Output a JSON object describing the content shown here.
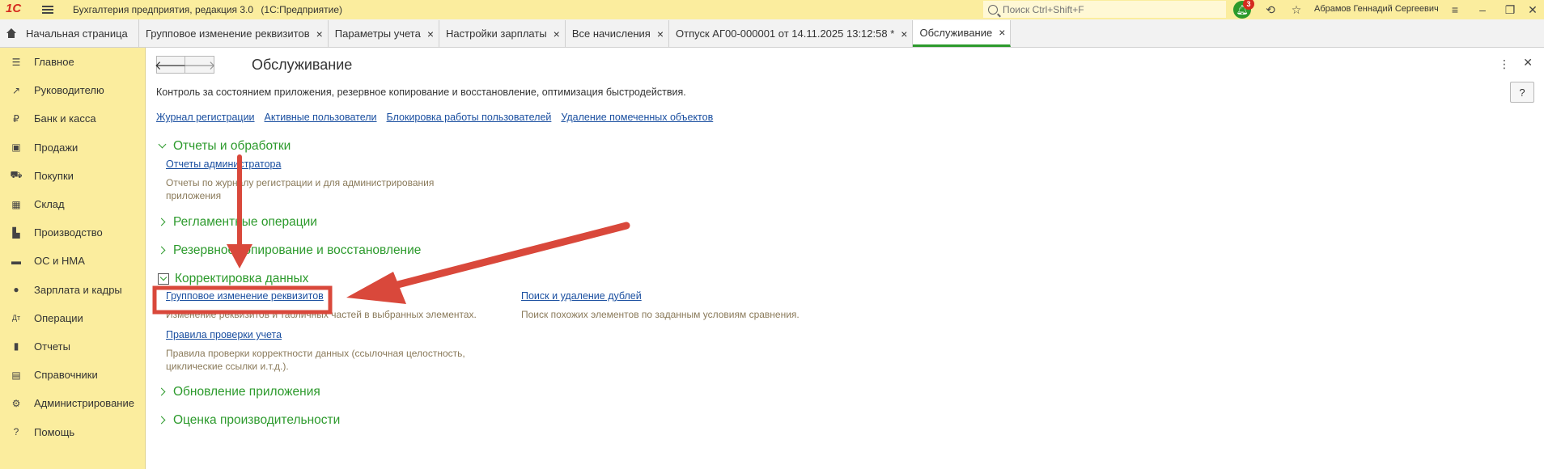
{
  "titlebar": {
    "logo_text": "1С",
    "app_name": "Бухгалтерия предприятия, редакция 3.0",
    "platform": "(1С:Предприятие)",
    "search_placeholder": "Поиск Ctrl+Shift+F",
    "notifications_count": "3",
    "user_name": "Абрамов Геннадий Сергеевич"
  },
  "tabs": {
    "home": "Начальная страница",
    "items": [
      {
        "label": "Групповое изменение реквизитов"
      },
      {
        "label": "Параметры учета"
      },
      {
        "label": "Настройки зарплаты"
      },
      {
        "label": "Все начисления"
      },
      {
        "label": "Отпуск АГ00-000001 от 14.11.2025 13:12:58 *"
      },
      {
        "label": "Обслуживание"
      }
    ],
    "close_glyph": "×"
  },
  "sidebar": {
    "items": [
      {
        "label": "Главное",
        "icon": "menu-icon"
      },
      {
        "label": "Руководителю",
        "icon": "trend-icon"
      },
      {
        "label": "Банк и касса",
        "icon": "ruble-icon"
      },
      {
        "label": "Продажи",
        "icon": "bag-icon"
      },
      {
        "label": "Покупки",
        "icon": "cart-icon"
      },
      {
        "label": "Склад",
        "icon": "grid-icon"
      },
      {
        "label": "Производство",
        "icon": "factory-icon"
      },
      {
        "label": "ОС и НМА",
        "icon": "truck-icon"
      },
      {
        "label": "Зарплата и кадры",
        "icon": "person-icon"
      },
      {
        "label": "Операции",
        "icon": "dt-kt-icon"
      },
      {
        "label": "Отчеты",
        "icon": "chart-icon"
      },
      {
        "label": "Справочники",
        "icon": "book-icon"
      },
      {
        "label": "Администрирование",
        "icon": "gear-icon"
      },
      {
        "label": "Помощь",
        "icon": "question-icon"
      }
    ]
  },
  "main": {
    "title": "Обслуживание",
    "help_label": "?",
    "description": "Контроль за состоянием приложения, резервное копирование и восстановление, оптимизация быстродействия.",
    "top_links": [
      "Журнал регистрации",
      "Активные пользователи",
      "Блокировка работы пользователей",
      "Удаление помеченных объектов"
    ],
    "sections": {
      "reports": {
        "title": "Отчеты и обработки",
        "link": "Отчеты администратора",
        "desc_line1": "Отчеты по журналу регистрации и для администрирования",
        "desc_line2": "приложения"
      },
      "routine": {
        "title": "Регламентные операции"
      },
      "backup": {
        "title": "Резервное копирование и восстановление"
      },
      "correction": {
        "title": "Корректировка данных",
        "link1": "Групповое изменение реквизитов",
        "desc1": "Изменение реквизитов и табличных частей в выбранных элементах.",
        "link2": "Поиск и удаление дублей",
        "desc2": "Поиск похожих элементов по заданным условиям сравнения.",
        "link3": "Правила проверки учета",
        "desc3_line1": "Правила проверки корректности данных (ссылочная целостность,",
        "desc3_line2": "циклические ссылки и.т.д.)."
      },
      "update": {
        "title": "Обновление приложения"
      },
      "performance": {
        "title": "Оценка производительности"
      }
    }
  },
  "colors": {
    "accent_green": "#2c9a2c",
    "panel_yellow": "#fbed9e",
    "link_blue": "#1a4fa0",
    "annotation_red": "#d9483b"
  }
}
